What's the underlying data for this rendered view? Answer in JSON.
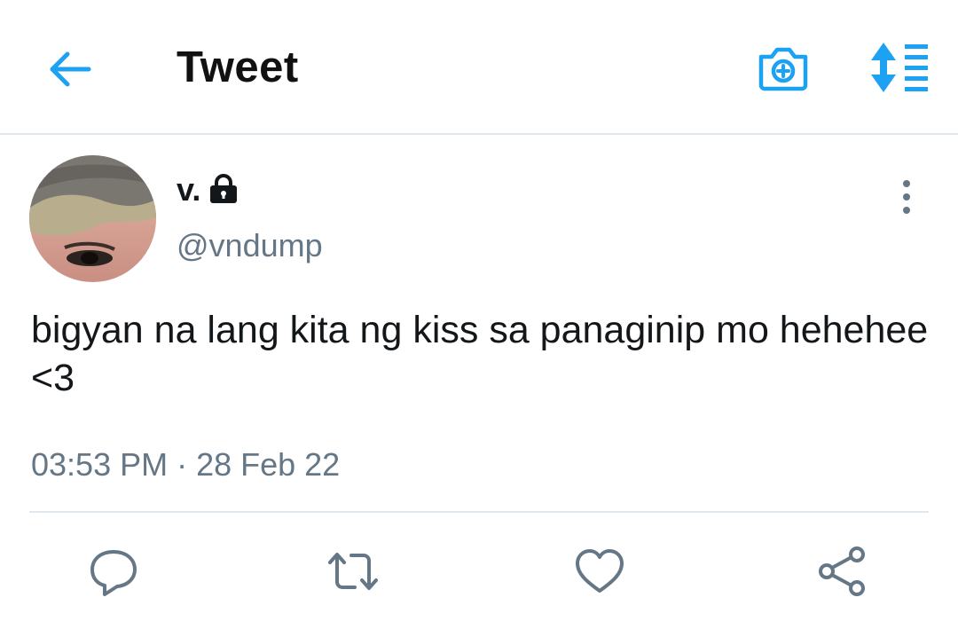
{
  "header": {
    "title": "Tweet",
    "back_icon": "arrow-left-icon",
    "camera_icon": "camera-add-icon",
    "sort_icon": "sort-list-icon",
    "accent_color": "#1da1f2"
  },
  "tweet": {
    "display_name": "v.",
    "protected_icon": "lock-icon",
    "handle": "@vndump",
    "text": "bigyan na lang kita ng kiss sa panaginip mo hehehee <3",
    "timestamp": "03:53 PM · 28 Feb 22",
    "more_icon": "vertical-dots-icon"
  },
  "actions": [
    {
      "name": "reply",
      "icon": "reply-bubble-icon"
    },
    {
      "name": "retweet",
      "icon": "retweet-icon"
    },
    {
      "name": "like",
      "icon": "heart-icon"
    },
    {
      "name": "share",
      "icon": "share-icon"
    }
  ],
  "colors": {
    "text_primary": "#14171a",
    "text_secondary": "#657786",
    "divider": "#e1e8ed",
    "icon_gray": "#657786"
  }
}
